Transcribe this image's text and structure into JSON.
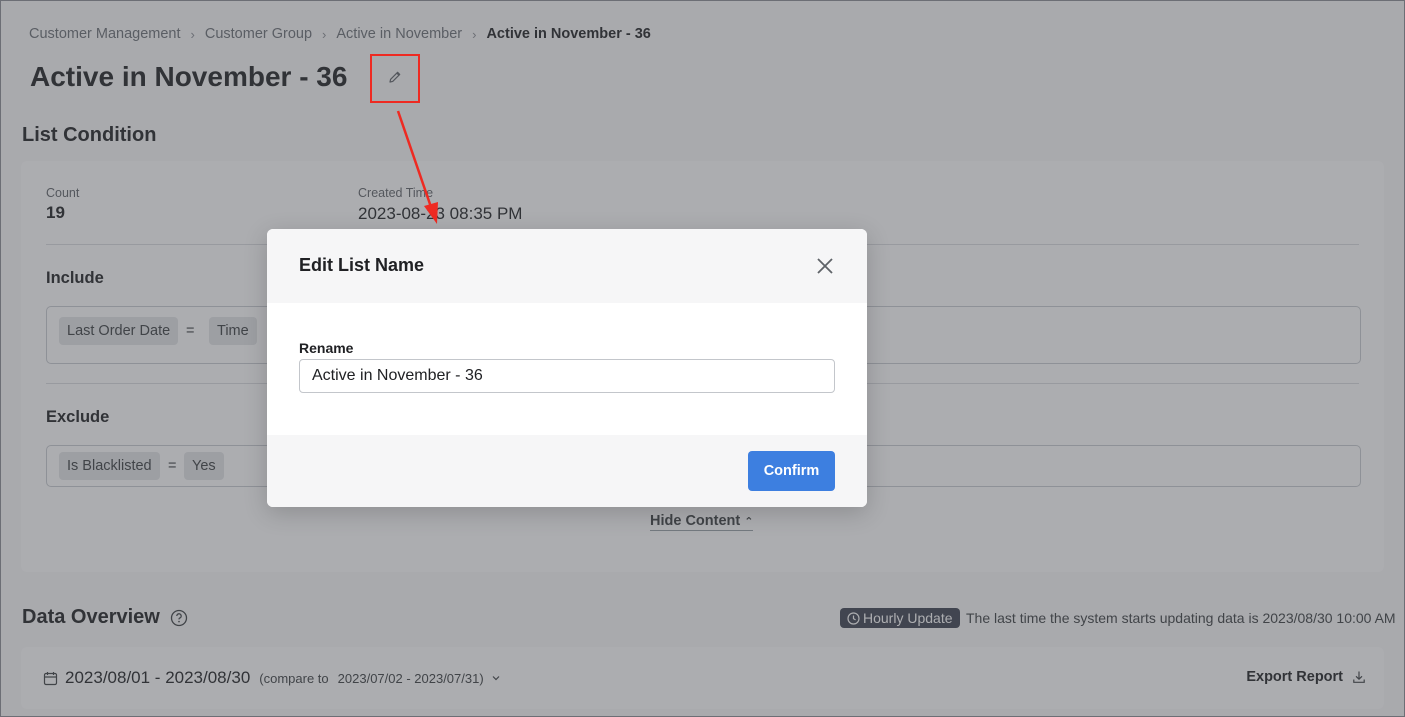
{
  "breadcrumb": {
    "items": [
      "Customer Management",
      "Customer Group",
      "Active in November"
    ],
    "current": "Active in November - 36"
  },
  "page": {
    "title": "Active in November - 36"
  },
  "list_condition": {
    "title": "List Condition",
    "count_label": "Count",
    "count_value": "19",
    "created_label": "Created Time",
    "created_value": "2023-08-23 08:35 PM",
    "include": {
      "title": "Include",
      "field": "Last Order Date",
      "operator": "=",
      "value": "Time"
    },
    "exclude": {
      "title": "Exclude",
      "field": "Is Blacklisted",
      "operator": "=",
      "value": "Yes"
    },
    "hide_content": "Hide Content"
  },
  "data_overview": {
    "title": "Data Overview",
    "badge": "Hourly Update",
    "update_text": "The last time the system starts updating data is 2023/08/30 10:00 AM",
    "date_range": "2023/08/01 - 2023/08/30",
    "compare_label": "(compare to",
    "compare_range": "2023/07/02 - 2023/07/31)",
    "export_label": "Export Report"
  },
  "modal": {
    "title": "Edit List Name",
    "field_label": "Rename",
    "field_value": "Active in November - 36",
    "confirm_label": "Confirm"
  },
  "colors": {
    "primary": "#3d7fe0",
    "annotation": "#ee2a22",
    "badge_bg": "#3c4250",
    "overlay": "rgba(70,73,80,0.45)"
  },
  "icons": [
    "chevron-right-icon",
    "pencil-icon",
    "help-circle-icon",
    "clock-icon",
    "calendar-icon",
    "chevron-down-icon",
    "download-icon",
    "close-icon",
    "chevron-up-icon"
  ]
}
